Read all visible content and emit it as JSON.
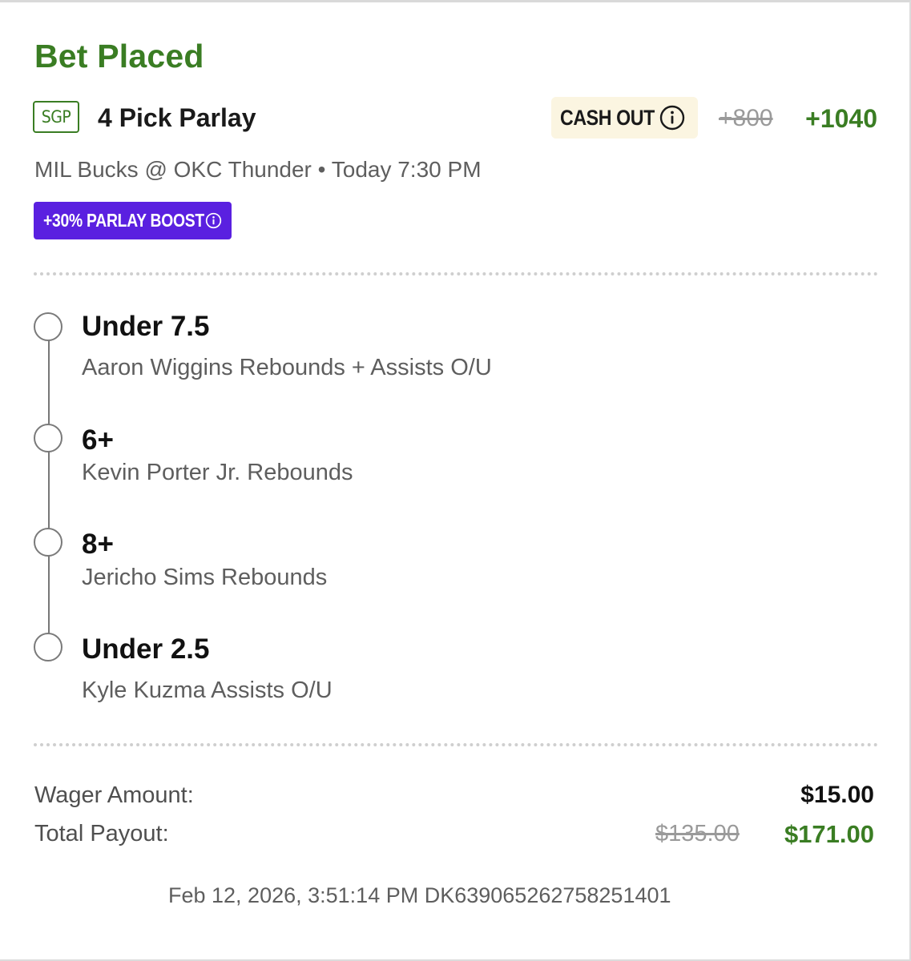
{
  "status": {
    "title": "Bet Placed"
  },
  "bet": {
    "badge": "SGP",
    "type": "4 Pick Parlay",
    "cash_out_label": "CASH OUT",
    "odds_original": "+800",
    "odds_boosted": "+1040",
    "matchup": "MIL Bucks @ OKC Thunder • Today 7:30 PM",
    "boost_label": "+30% PARLAY BOOST"
  },
  "legs": [
    {
      "line": "Under 7.5",
      "market": "Aaron Wiggins Rebounds + Assists O/U"
    },
    {
      "line": "6+",
      "market": "Kevin Porter Jr. Rebounds"
    },
    {
      "line": "8+",
      "market": "Jericho Sims Rebounds"
    },
    {
      "line": "Under 2.5",
      "market": "Kyle Kuzma Assists O/U"
    }
  ],
  "summary": {
    "wager_label": "Wager Amount:",
    "wager_value": "$15.00",
    "payout_label": "Total Payout:",
    "payout_original": "$135.00",
    "payout_boosted": "$171.00"
  },
  "footer": {
    "meta": "Feb 12, 2026, 3:51:14 PM DK639065262758251401"
  },
  "colors": {
    "accent_green": "#3a7d23",
    "boost_purple": "#5a20e0",
    "cash_out_bg": "#fbf5e1"
  },
  "icons": {
    "cash_out_info": "info-circle-icon",
    "boost_info": "info-circle-icon",
    "leg_status": "empty-circle-icon"
  }
}
